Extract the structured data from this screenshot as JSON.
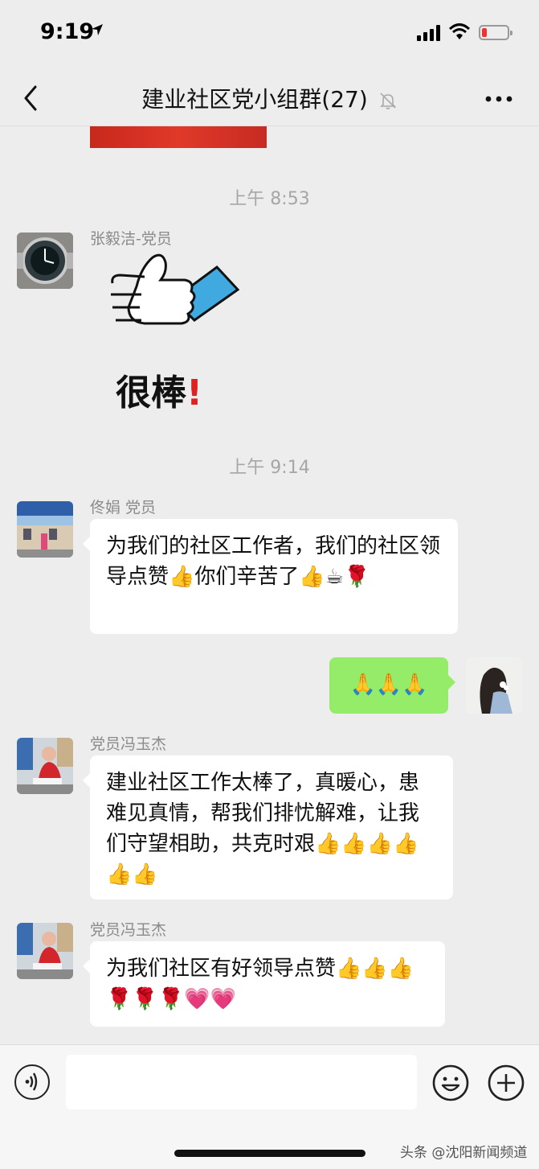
{
  "status": {
    "time": "9:19"
  },
  "header": {
    "title": "建业社区党小组群(27)"
  },
  "chat": {
    "stamp1": "上午 8:53",
    "msg1_sender": "张毅洁-党员",
    "sticker_text": "很棒",
    "sticker_mark": "!",
    "stamp2": "上午 9:14",
    "msg2_sender": "佟娟 党员",
    "msg2_text": "为我们的社区工作者，我们的社区领导点赞👍你们辛苦了👍☕🌹",
    "msg3_text": "🙏🙏🙏",
    "msg4_sender": "党员冯玉杰",
    "msg4_text": "建业社区工作太棒了，真暖心，患难见真情，帮我们排忧解难，让我们守望相助，共克时艰👍👍👍👍👍👍",
    "msg5_sender": "党员冯玉杰",
    "msg5_text": "为我们社区有好领导点赞👍👍👍🌹🌹🌹💗💗"
  },
  "footer": {
    "watermark": "头条 @沈阳新闻频道"
  },
  "colors": {
    "bubble_self": "#95ec69",
    "background": "#ededed"
  }
}
